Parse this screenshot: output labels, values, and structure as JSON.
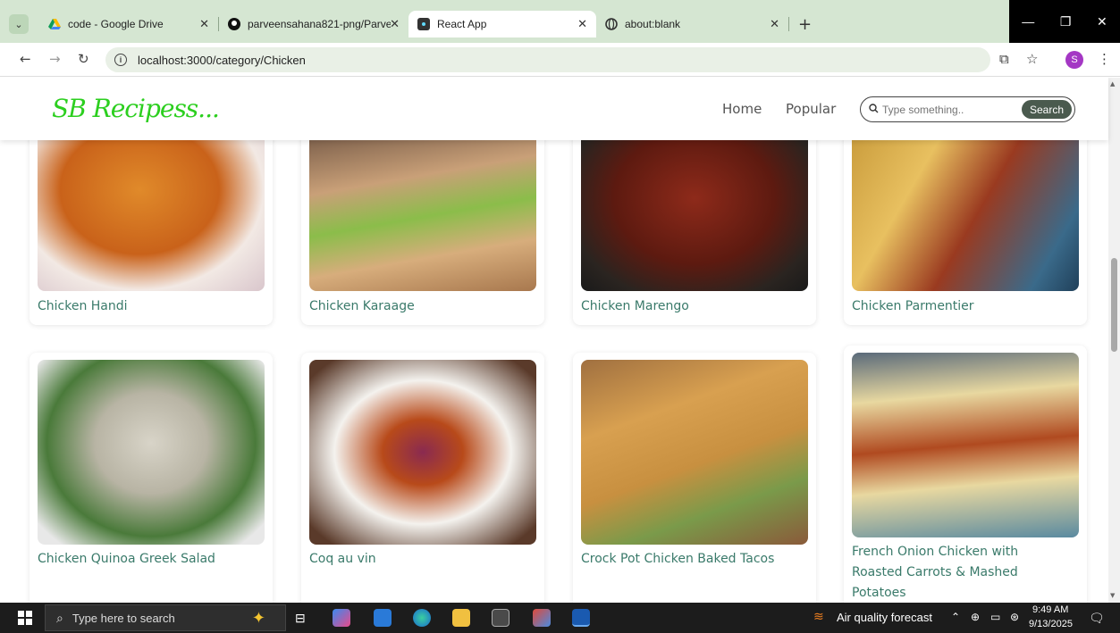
{
  "browser": {
    "tabs": [
      {
        "title": "code - Google Drive",
        "icon": "google-drive-icon",
        "active": false
      },
      {
        "title": "parveensahana821-png/Parvee",
        "icon": "github-icon",
        "active": false
      },
      {
        "title": "React App",
        "icon": "react-icon",
        "active": true
      },
      {
        "title": "about:blank",
        "icon": "globe-icon",
        "active": false
      }
    ],
    "url": "localhost:3000/category/Chicken",
    "profile_initial": "S"
  },
  "site": {
    "logo": "SB Recipess...",
    "nav": {
      "home": "Home",
      "popular": "Popular"
    },
    "search": {
      "placeholder": "Type something..",
      "button": "Search"
    }
  },
  "recipes": [
    {
      "name": "Chicken Handi"
    },
    {
      "name": "Chicken Karaage"
    },
    {
      "name": "Chicken Marengo"
    },
    {
      "name": "Chicken Parmentier"
    },
    {
      "name": "Chicken Quinoa Greek Salad"
    },
    {
      "name": "Coq au vin"
    },
    {
      "name": "Crock Pot Chicken Baked Tacos"
    },
    {
      "name": "French Onion Chicken with Roasted Carrots & Mashed Potatoes"
    }
  ],
  "taskbar": {
    "search_placeholder": "Type here to search",
    "weather": "Air quality forecast",
    "time": "9:49 AM",
    "date": "9/13/2025"
  },
  "colors": {
    "logo": "#2ccf1f",
    "recipe_title": "#3a7a6a",
    "chrome_bg": "#d5e6d2"
  }
}
